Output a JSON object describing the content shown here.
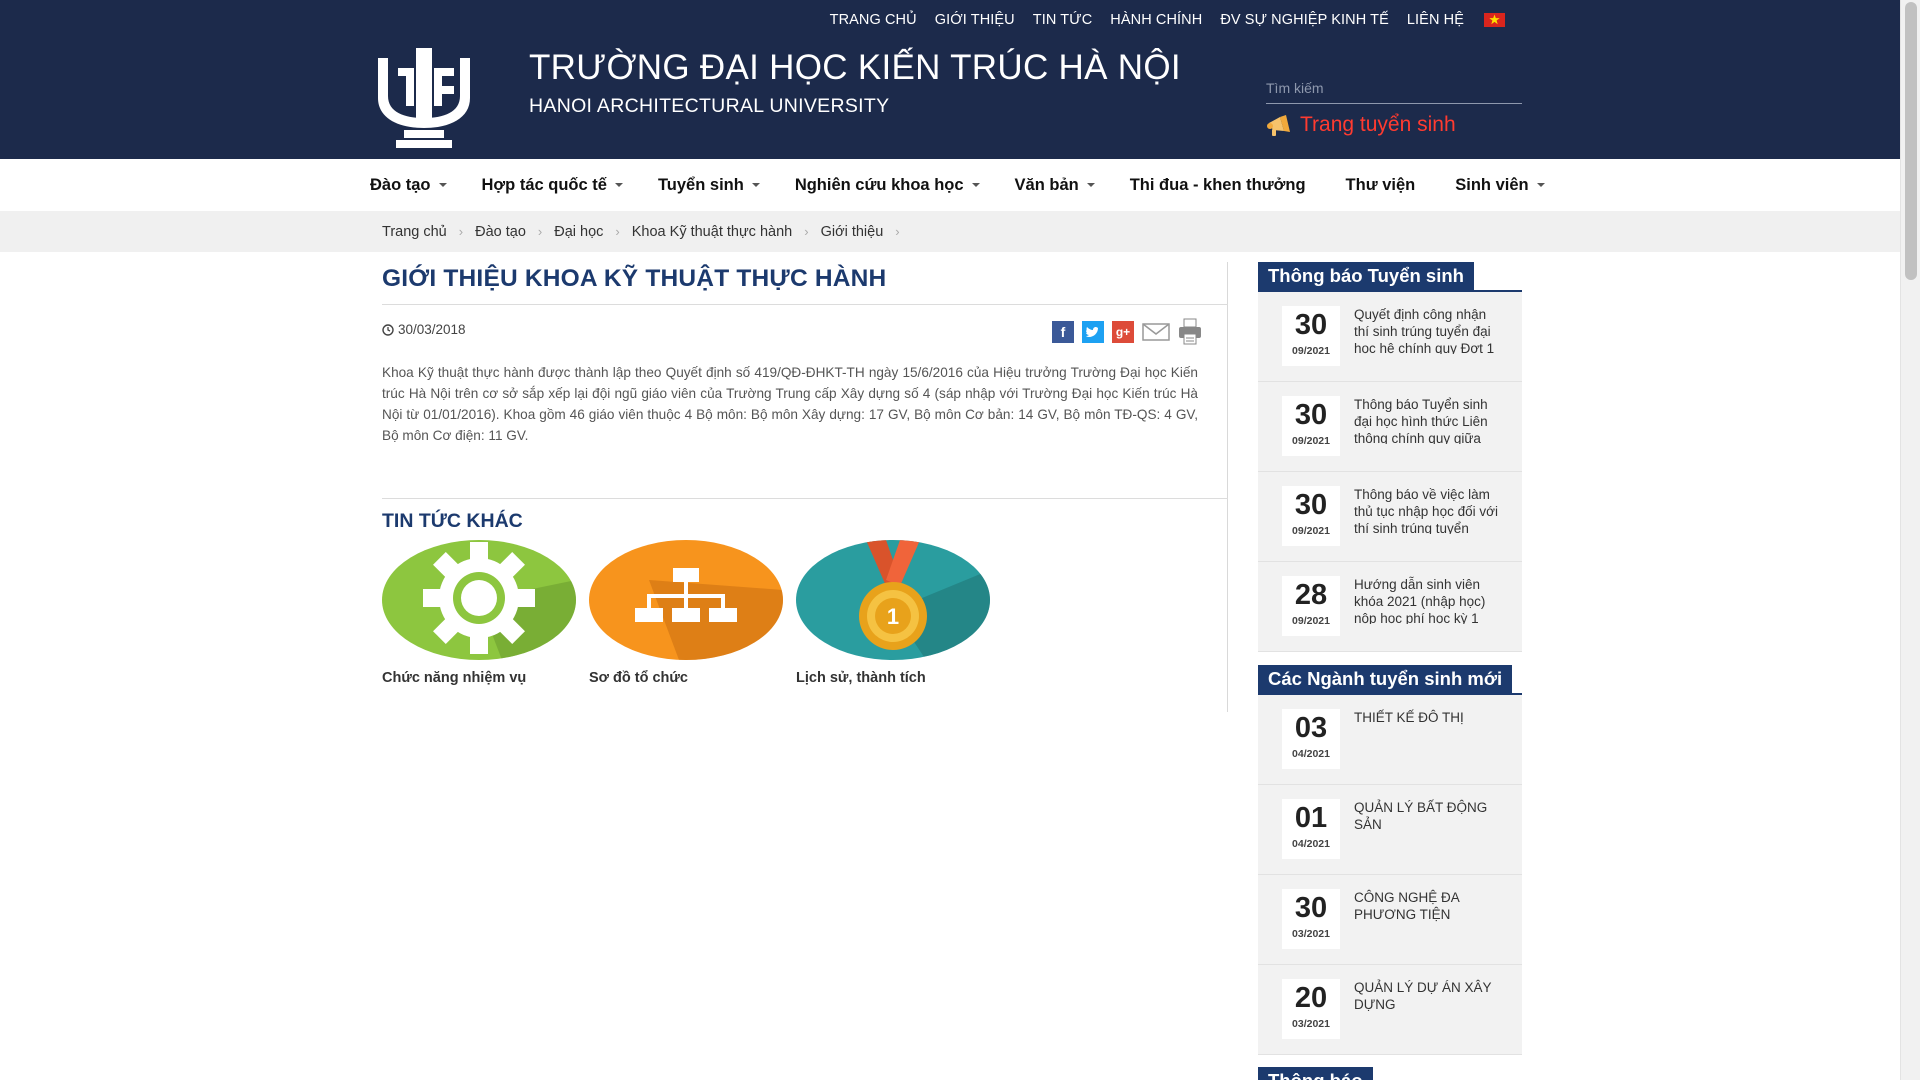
{
  "topnav": {
    "items": [
      "TRANG CHỦ",
      "GIỚI THIỆU",
      "TIN TỨC",
      "HÀNH CHÍNH",
      "ĐV SỰ NGHIỆP KINH TẾ",
      "LIÊN HỆ"
    ],
    "flag_icon": "vietnam-flag-icon"
  },
  "brand": {
    "title": "TRƯỜNG ĐẠI HỌC KIẾN TRÚC HÀ NỘI",
    "subtitle": "HANOI ARCHITECTURAL UNIVERSITY",
    "logo_icon": "hau-logo-icon"
  },
  "search": {
    "placeholder": "Tìm kiếm"
  },
  "recruit": {
    "label": "Trang tuyển sinh",
    "icon": "megaphone-icon"
  },
  "mainnav": {
    "items": [
      {
        "label": "Đào tạo",
        "dropdown": true
      },
      {
        "label": "Hợp tác quốc tế",
        "dropdown": true
      },
      {
        "label": "Tuyển sinh",
        "dropdown": true
      },
      {
        "label": "Nghiên cứu khoa học",
        "dropdown": true
      },
      {
        "label": "Văn bản",
        "dropdown": true
      },
      {
        "label": "Thi đua - khen thưởng",
        "dropdown": false
      },
      {
        "label": "Thư viện",
        "dropdown": false
      },
      {
        "label": "Sinh viên",
        "dropdown": true
      }
    ]
  },
  "breadcrumb": [
    "Trang chủ",
    "Đào tạo",
    "Đại học",
    "Khoa Kỹ thuật thực hành",
    "Giới thiệu"
  ],
  "article": {
    "title": "GIỚI THIỆU KHOA KỸ THUẬT THỰC HÀNH",
    "date": "30/03/2018",
    "body": "Khoa Kỹ thuật thực hành được thành lập theo Quyết định số 419/QĐ-ĐHKT-TH ngày 15/6/2016 của Hiệu trưởng Trường Đại học Kiến trúc Hà Nội trên cơ sở sắp xếp lại đội ngũ giáo viên của Trường Trung cấp Xây dựng số 4 (sáp nhập với Trường Đại học Kiến trúc Hà Nội từ 01/01/2016). Khoa gồm 46 giáo viên thuộc 4 Bộ môn: Bộ môn Xây dựng: 17 GV, Bộ môn Cơ bản: 14 GV, Bộ môn TĐ-QS: 4 GV, Bộ môn Cơ điện: 11 GV.",
    "share_icons": [
      "facebook-icon",
      "twitter-icon",
      "google-plus-icon",
      "email-icon",
      "print-icon"
    ]
  },
  "other_news": {
    "heading": "TIN TỨC KHÁC",
    "cards": [
      {
        "caption": "Chức năng nhiệm vụ",
        "color": "#8dc63f",
        "icon": "gear-icon"
      },
      {
        "caption": "Sơ đồ tổ chức",
        "color": "#f7941d",
        "icon": "org-chart-icon"
      },
      {
        "caption": "Lịch sử, thành tích",
        "color": "#2a9d9f",
        "icon": "medal-icon"
      }
    ]
  },
  "sidebar": {
    "box1": {
      "title": "Thông báo Tuyển sinh",
      "items": [
        {
          "day": "30",
          "month": "09/2021",
          "text": "Quyết định công nhận thí sinh trúng tuyển đại học hệ chính quy Đợt 1"
        },
        {
          "day": "30",
          "month": "09/2021",
          "text": "Thông báo Tuyển sinh đại học hình thức Liên thông chính quy giữa"
        },
        {
          "day": "30",
          "month": "09/2021",
          "text": "Thông báo về việc làm thủ tục nhập học đối với thí sinh trúng tuyển"
        },
        {
          "day": "28",
          "month": "09/2021",
          "text": "Hướng dẫn sinh viên khóa 2021 (nhập học) nộp học phí học kỳ 1"
        }
      ]
    },
    "box2": {
      "title": "Các Ngành tuyển sinh mới",
      "items": [
        {
          "day": "03",
          "month": "04/2021",
          "text": "THIẾT KẾ ĐÔ THỊ"
        },
        {
          "day": "01",
          "month": "04/2021",
          "text": "QUẢN LÝ BẤT ĐỘNG SẢN"
        },
        {
          "day": "30",
          "month": "03/2021",
          "text": "CÔNG NGHỆ ĐA PHƯƠNG TIỆN"
        },
        {
          "day": "20",
          "month": "03/2021",
          "text": "QUẢN LÝ DỰ ÁN XÂY DỰNG"
        }
      ]
    },
    "box3": {
      "title": "Thông báo"
    }
  },
  "colors": {
    "header_bg": "#1c2a4b",
    "accent": "#1c3a6e",
    "recruit": "#ff3b30"
  }
}
